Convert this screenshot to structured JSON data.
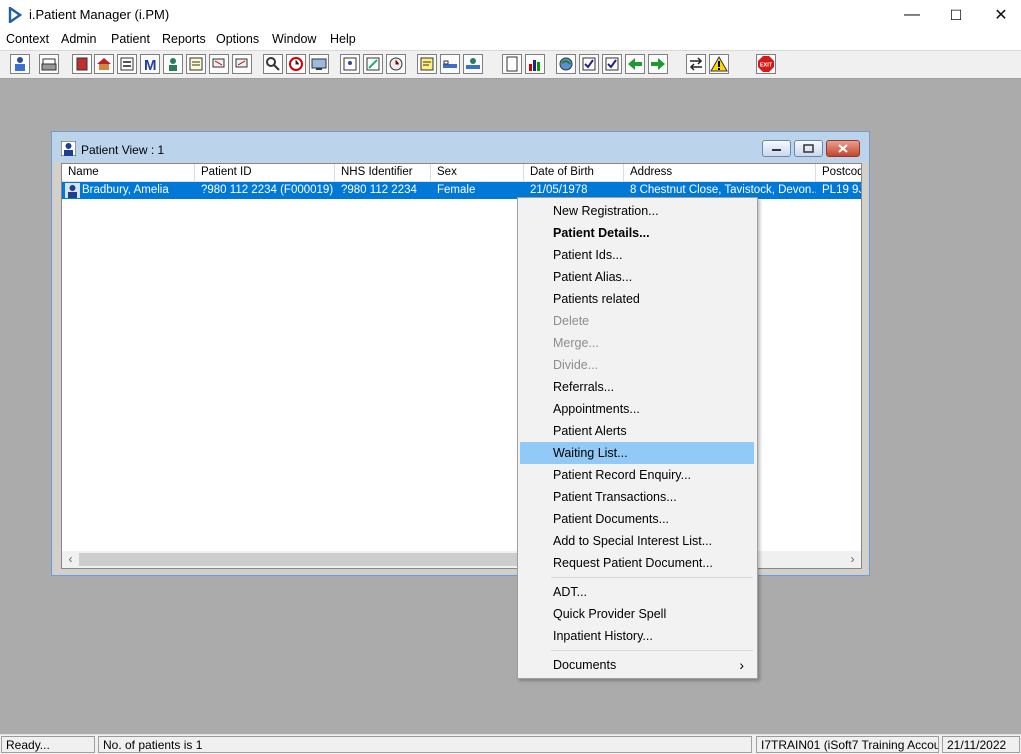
{
  "app": {
    "title": "i.Patient Manager (i.PM)"
  },
  "window_controls": {
    "minimize": "—",
    "maximize": "☐",
    "close": "✕"
  },
  "menubar": {
    "items": [
      "Context",
      "Admin",
      "Patient",
      "Reports",
      "Options",
      "Window",
      "Help"
    ]
  },
  "toolbar": {
    "buttons": [
      {
        "icon": "user-search-icon"
      },
      {
        "icon": "printer-icon"
      },
      {
        "icon": "book-red-icon"
      },
      {
        "icon": "house-icon"
      },
      {
        "icon": "form-icon"
      },
      {
        "icon": "letter-m-icon"
      },
      {
        "icon": "person-icon"
      },
      {
        "icon": "notes-icon"
      },
      {
        "icon": "flag-icon"
      },
      {
        "icon": "flag-icon"
      },
      {
        "icon": "magnifier-icon"
      },
      {
        "icon": "clock-icon"
      },
      {
        "icon": "monitor-icon"
      },
      {
        "icon": "document-person-icon"
      },
      {
        "icon": "document-edit-icon"
      },
      {
        "icon": "clock-arrow-icon"
      },
      {
        "icon": "note-icon"
      },
      {
        "icon": "bed-icon"
      },
      {
        "icon": "bed-person-icon"
      },
      {
        "icon": "page-icon"
      },
      {
        "icon": "bar-chart-icon"
      },
      {
        "icon": "globe-icon"
      },
      {
        "icon": "checklist-icon"
      },
      {
        "icon": "checklist-icon"
      },
      {
        "icon": "green-arrows-icon"
      },
      {
        "icon": "green-arrows-icon"
      },
      {
        "icon": "transfer-icon"
      },
      {
        "icon": "warning-icon"
      },
      {
        "icon": "exit-icon",
        "label": "EXIT"
      }
    ]
  },
  "patient_view": {
    "title": "Patient View : 1",
    "columns": [
      "Name",
      "Patient ID",
      "NHS Identifier",
      "Sex",
      "Date of Birth",
      "Address",
      "Postcode"
    ],
    "rows": [
      {
        "name": "Bradbury, Amelia",
        "patient_id": "?980 112 2234 (F000019)",
        "nhs": "?980 112 2234",
        "sex": "Female",
        "dob": "21/05/1978",
        "address": "8 Chestnut Close, Tavistock, Devon...",
        "postcode": "PL19 9J"
      }
    ]
  },
  "context_menu": {
    "items": [
      {
        "label": "New Registration..."
      },
      {
        "label": "Patient Details..."
      },
      {
        "label": "Patient Ids..."
      },
      {
        "label": "Patient Alias..."
      },
      {
        "label": "Patients related"
      },
      {
        "label": "Delete"
      },
      {
        "label": "Merge..."
      },
      {
        "label": "Divide..."
      },
      {
        "label": "Referrals..."
      },
      {
        "label": "Appointments..."
      },
      {
        "label": "Patient Alerts"
      },
      {
        "label": "Waiting List..."
      },
      {
        "label": "Patient Record Enquiry..."
      },
      {
        "label": "Patient Transactions..."
      },
      {
        "label": "Patient Documents..."
      },
      {
        "label": "Add to Special Interest List..."
      },
      {
        "label": "Request Patient Document..."
      },
      {
        "label": "ADT..."
      },
      {
        "label": "Quick Provider Spell"
      },
      {
        "label": "Inpatient History..."
      },
      {
        "label": "Documents",
        "submenu_arrow": "›"
      }
    ]
  },
  "statusbar": {
    "status": "Ready...",
    "patient_count": "No. of patients is 1",
    "account": "I7TRAIN01 (iSoft7 Training Account)",
    "date": "21/11/2022"
  }
}
